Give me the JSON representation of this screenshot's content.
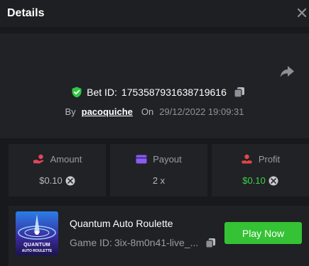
{
  "header": {
    "title": "Details"
  },
  "bet": {
    "id_label": "Bet ID:",
    "id": "1753587931638719616",
    "by_label": "By",
    "user": "pacoquiche",
    "on_label": "On",
    "date": "29/12/2022 19:09:31"
  },
  "stats": {
    "amount": {
      "label": "Amount",
      "value": "$0.10"
    },
    "payout": {
      "label": "Payout",
      "value": "2 x"
    },
    "profit": {
      "label": "Profit",
      "value": "$0.10"
    }
  },
  "game": {
    "name": "Quantum Auto Roulette",
    "id_label": "Game ID:",
    "id": "3ix-8m0n41-live_...",
    "thumb_line1": "QUANTUM",
    "thumb_line2": "AUTO ROULETTE",
    "play_label": "Play Now"
  },
  "colors": {
    "background": "#17191c",
    "panel": "#202226",
    "accent_green": "#35c234",
    "profit_green": "#3fd14a",
    "shield_green": "#2fc742",
    "amount_icon": "#e3455b",
    "payout_icon": "#8a5cf0",
    "profit_icon": "#e34545"
  },
  "icons": {
    "close": "close-icon",
    "share": "share-icon",
    "shield": "shield-check-icon",
    "copy": "copy-icon",
    "coin": "coin-icon",
    "amount": "hand-coins-icon",
    "payout": "card-icon",
    "profit": "profit-icon"
  }
}
